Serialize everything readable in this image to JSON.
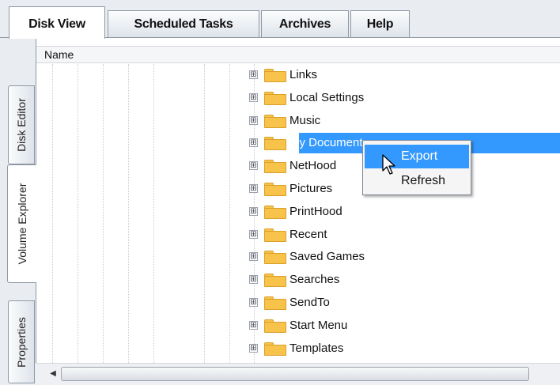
{
  "tabs": [
    {
      "label": "Disk View",
      "active": true
    },
    {
      "label": "Scheduled Tasks",
      "active": false
    },
    {
      "label": "Archives",
      "active": false
    },
    {
      "label": "Help",
      "active": false
    }
  ],
  "side_tabs": [
    {
      "label": "Disk Editor",
      "active": false
    },
    {
      "label": "Volume Explorer",
      "active": true
    },
    {
      "label": "Properties",
      "active": false
    }
  ],
  "column_header": "Name",
  "tree": [
    {
      "label": "Links",
      "selected": false
    },
    {
      "label": "Local Settings",
      "selected": false
    },
    {
      "label": "Music",
      "selected": false
    },
    {
      "label": "My Documents",
      "selected": true
    },
    {
      "label": "NetHood",
      "selected": false
    },
    {
      "label": "Pictures",
      "selected": false
    },
    {
      "label": "PrintHood",
      "selected": false
    },
    {
      "label": "Recent",
      "selected": false
    },
    {
      "label": "Saved Games",
      "selected": false
    },
    {
      "label": "Searches",
      "selected": false
    },
    {
      "label": "SendTo",
      "selected": false
    },
    {
      "label": "Start Menu",
      "selected": false
    },
    {
      "label": "Templates",
      "selected": false
    }
  ],
  "expander_symbol": "⊞",
  "context_menu": {
    "items": [
      {
        "label": "Export",
        "hover": true
      },
      {
        "label": "Refresh",
        "hover": false
      }
    ]
  },
  "scrollbar": {
    "left_arrow": "◀"
  },
  "colors": {
    "selection": "#3399ff",
    "folder": "#f8c34b",
    "chrome": "#e9edf2"
  }
}
